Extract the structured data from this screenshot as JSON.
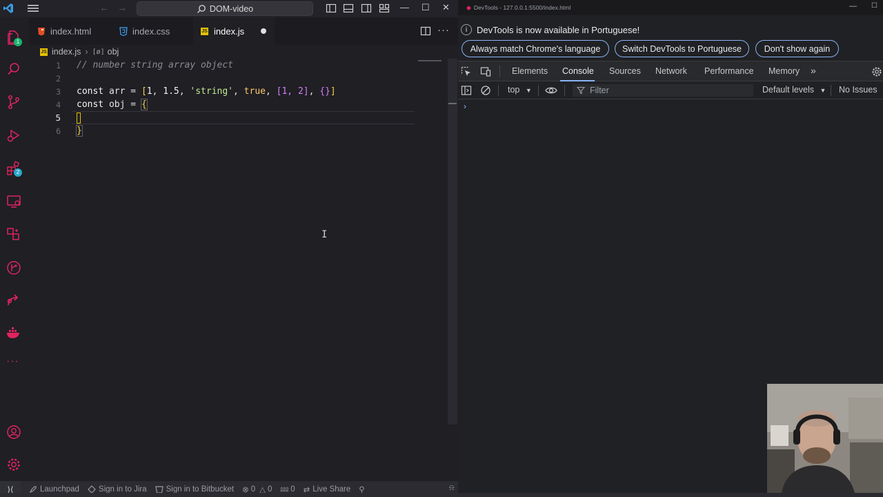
{
  "vscode": {
    "title": "DOM-video",
    "tabs": [
      {
        "label": "index.html",
        "icon": "html5-icon",
        "color": "#e44d26",
        "modified": false
      },
      {
        "label": "index.css",
        "icon": "css3-icon",
        "color": "#42a5f5",
        "modified": false
      },
      {
        "label": "index.js",
        "icon": "js-icon",
        "color": "#e5c100",
        "modified": true
      }
    ],
    "breadcrumb": {
      "file": "index.js",
      "symbol": "obj"
    },
    "code": {
      "line1": "// number string array object",
      "line3_kw": "const",
      "line3_name": " arr = ",
      "line3_n1": "1",
      "line3_n2": "1.5",
      "line3_str": "'string'",
      "line3_bool": "true",
      "line3_inner": "[1, 2]",
      "line3_obj": "{}",
      "line4_kw": "const",
      "line4_name": " obj = ",
      "line4_brace": "{",
      "line6_brace": "}"
    },
    "line_numbers": [
      "1",
      "2",
      "3",
      "4",
      "5",
      "6"
    ],
    "status": {
      "launchpad": "Launchpad",
      "jira": "Sign in to Jira",
      "bitbucket": "Sign in to Bitbucket",
      "errors": "0",
      "warnings": "0",
      "ports": "0",
      "liveshare": "Live Share"
    },
    "badges": {
      "explorer": "1",
      "extensions": "2"
    },
    "accent": "#e0245e"
  },
  "devtools": {
    "window_title": "DevTools - 127.0.0.1:5500/index.html",
    "info_message": "DevTools is now available in Portuguese!",
    "buttons": {
      "match": "Always match Chrome's language",
      "switch": "Switch DevTools to Portuguese",
      "dismiss": "Don't show again"
    },
    "tabs": [
      "Elements",
      "Console",
      "Sources",
      "Network",
      "Performance",
      "Memory"
    ],
    "active_tab": "Console",
    "console": {
      "context": "top",
      "filter_placeholder": "Filter",
      "levels": "Default levels",
      "issues": "No Issues",
      "prompt": "›"
    },
    "accent": "#8ab4f8"
  }
}
